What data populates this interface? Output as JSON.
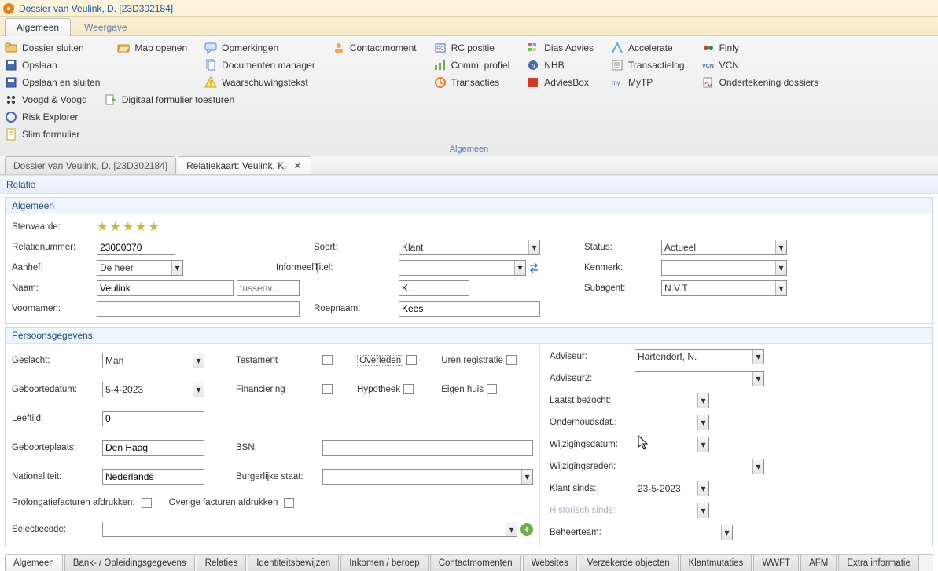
{
  "window": {
    "title": "Dossier van Veulink,  D. [23D302184]"
  },
  "main_tabs": {
    "active": "Algemeen",
    "other": "Weergave"
  },
  "ribbon": {
    "group_label": "Algemeen",
    "cols": {
      "c0": [
        "Dossier sluiten",
        "Opslaan",
        "Opslaan en sluiten"
      ],
      "c1": [
        "Map openen"
      ],
      "c2": [
        "Opmerkingen",
        "Documenten manager",
        "Waarschuwingstekst"
      ],
      "c3": [
        "Contactmoment"
      ],
      "c4": [
        "RC positie",
        "Comm. profiel",
        "Transacties"
      ],
      "c5": [
        "Dias Advies",
        "NHB",
        "AdviesBox"
      ],
      "c6": [
        "Accelerate",
        "Transactielog",
        "MyTP"
      ],
      "c7": [
        "Finly",
        "VCN",
        "Ondertekening dossiers"
      ],
      "c8": [
        "Voogd & Voogd",
        "Risk Explorer",
        "Slim formulier"
      ],
      "c9": [
        "Digitaal formulier toesturen"
      ]
    }
  },
  "doc_tabs": {
    "t0": "Dossier van Veulink, D. [23D302184]",
    "t1": "Relatiekaart: Veulink, K."
  },
  "section": "Relatie",
  "groups": {
    "algemeen": "Algemeen",
    "persoon": "Persoonsgegevens"
  },
  "labels": {
    "sterwaarde": "Sterwaarde:",
    "relatienummer": "Relatienummer:",
    "soort": "Soort:",
    "status": "Status:",
    "aanhef": "Aanhef:",
    "informeel": "Informeel",
    "titel": "Titel:",
    "kenmerk": "Kenmerk:",
    "naam": "Naam:",
    "tussenv": "tussenv.",
    "subagent": "Subagent:",
    "voornamen": "Voornamen:",
    "roepnaam": "Roepnaam:",
    "geslacht": "Geslacht:",
    "testament": "Testament",
    "overleden": "Overleden",
    "uren": "Uren registratie",
    "geboortedatum": "Geboortedatum:",
    "financiering": "Financiering",
    "hypotheek": "Hypotheek",
    "eigenhuis": "Eigen huis",
    "leeftijd": "Leeftijd:",
    "geboorteplaats": "Geboorteplaats:",
    "bsn": "BSN:",
    "nationaliteit": "Nationaliteit:",
    "burgerlijk": "Burgerlijke staat:",
    "prolong": "Prolongatiefacturen afdrukken:",
    "overige": "Overige facturen afdrukken",
    "selectiecode": "Selectiecode:",
    "adviseur": "Adviseur:",
    "adviseur2": "Adviseur2:",
    "laatstbezocht": "Laatst bezocht:",
    "onderhoudsdat": "Onderhoudsdat.:",
    "wijzdatum": "Wijzigingsdatum:",
    "wijzreden": "Wijzigingsreden:",
    "klantsinds": "Klant sinds:",
    "historisch": "Historisch sinds:",
    "beheerteam": "Beheerteam:"
  },
  "values": {
    "relatienummer": "23000070",
    "soort": "Klant",
    "status": "Actueel",
    "aanhef": "De heer",
    "naam": "Veulink",
    "initialen": "K.",
    "subagent": "N.V.T.",
    "roepnaam": "Kees",
    "geslacht": "Man",
    "geboortedatum": "5-4-2023",
    "leeftijd": "0",
    "geboorteplaats": "Den Haag",
    "nationaliteit": "Nederlands",
    "adviseur": "Hartendorf, N.",
    "klantsinds": "23-5-2023"
  },
  "bottom_tabs": [
    "Algemeen",
    "Bank- / Opleidingsgegevens",
    "Relaties",
    "Identiteitsbewijzen",
    "Inkomen / beroep",
    "Contactmomenten",
    "Websites",
    "Verzekerde objecten",
    "Klantmutaties",
    "WWFT",
    "AFM",
    "Extra informatie"
  ]
}
